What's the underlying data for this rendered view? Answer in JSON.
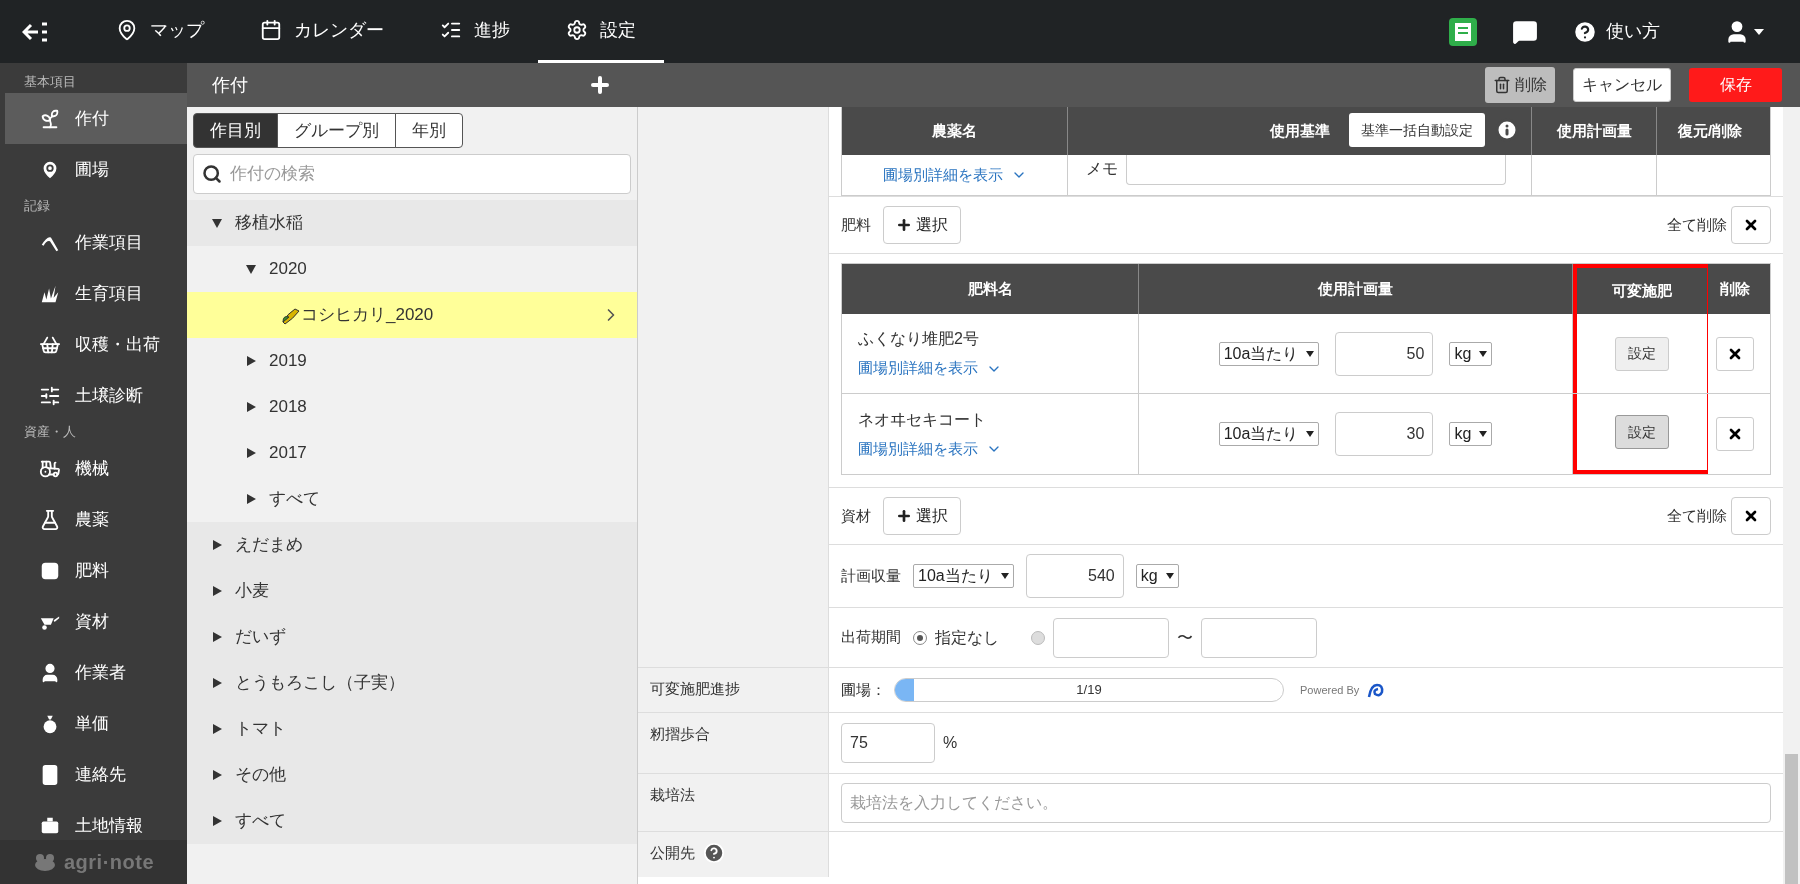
{
  "nav": {
    "items": [
      {
        "label": "マップ",
        "selected": false
      },
      {
        "label": "カレンダー",
        "selected": false
      },
      {
        "label": "進捗",
        "selected": false
      },
      {
        "label": "設定",
        "selected": true
      }
    ],
    "help": "使い方"
  },
  "sidebar": {
    "sections": [
      {
        "heading": "基本項目",
        "items": [
          {
            "label": "作付",
            "selected": true
          },
          {
            "label": "圃場",
            "selected": false
          }
        ]
      },
      {
        "heading": "記録",
        "items": [
          {
            "label": "作業項目",
            "selected": false
          },
          {
            "label": "生育項目",
            "selected": false
          },
          {
            "label": "収穫・出荷",
            "selected": false
          },
          {
            "label": "土壌診断",
            "selected": false
          }
        ]
      },
      {
        "heading": "資産・人",
        "items": [
          {
            "label": "機械",
            "selected": false
          },
          {
            "label": "農薬",
            "selected": false
          },
          {
            "label": "肥料",
            "selected": false
          },
          {
            "label": "資材",
            "selected": false
          },
          {
            "label": "作業者",
            "selected": false
          },
          {
            "label": "単価",
            "selected": false
          },
          {
            "label": "連絡先",
            "selected": false
          },
          {
            "label": "土地情報",
            "selected": false
          }
        ]
      }
    ],
    "logo": "agri·note"
  },
  "toolbar": {
    "title": "作付",
    "buttons": [
      {
        "label": "削除",
        "kind": "delete"
      },
      {
        "label": "キャンセル",
        "kind": "cancel"
      },
      {
        "label": "保存",
        "kind": "save"
      }
    ]
  },
  "tree": {
    "tabs": [
      {
        "label": "作目別",
        "selected": true
      },
      {
        "label": "グループ別",
        "selected": false
      },
      {
        "label": "年別",
        "selected": false
      }
    ],
    "search_placeholder": "作付の検索",
    "items": [
      {
        "label": "移植水稲",
        "kind": "group",
        "expanded": true,
        "selected": false,
        "children": [
          {
            "label": "2020",
            "kind": "group",
            "expanded": true,
            "selected": false,
            "children": [
              {
                "label": "コシヒカリ_2020",
                "kind": "crop",
                "selected": true
              }
            ]
          },
          {
            "label": "2019",
            "kind": "group",
            "expanded": false,
            "selected": false
          },
          {
            "label": "2018",
            "kind": "group",
            "expanded": false,
            "selected": false
          },
          {
            "label": "2017",
            "kind": "group",
            "expanded": false,
            "selected": false
          },
          {
            "label": "すべて",
            "kind": "group",
            "expanded": false,
            "selected": false
          }
        ]
      },
      {
        "label": "えだまめ",
        "kind": "group",
        "expanded": false,
        "selected": false
      },
      {
        "label": "小麦",
        "kind": "group",
        "expanded": false,
        "selected": false
      },
      {
        "label": "だいず",
        "kind": "group",
        "expanded": false,
        "selected": false
      },
      {
        "label": "とうもろこし（子実）",
        "kind": "group",
        "expanded": false,
        "selected": false
      },
      {
        "label": "トマト",
        "kind": "group",
        "expanded": false,
        "selected": false
      },
      {
        "label": "その他",
        "kind": "group",
        "expanded": false,
        "selected": false
      },
      {
        "label": "すべて",
        "kind": "group",
        "expanded": false,
        "selected": false
      }
    ]
  },
  "pesticide_table": {
    "columns": [
      "農薬名",
      "使用基準",
      "使用計画量",
      "復元/削除"
    ],
    "auto_button": "基準一括自動設定",
    "detail_link": "圃場別詳細を表示",
    "memo_label": "メモ"
  },
  "fertilizer": {
    "label": "肥料",
    "select_button": "選択",
    "clear_all": "全て削除",
    "columns": [
      {
        "label": "肥料名",
        "highlighted": false
      },
      {
        "label": "使用計画量",
        "highlighted": false
      },
      {
        "label": "可変施肥",
        "highlighted": true
      },
      {
        "label": "削除",
        "highlighted": false
      }
    ],
    "rows": [
      {
        "name": "ふくなり堆肥2号",
        "detail_link": "圃場別詳細を表示",
        "basis": "10a当たり",
        "amount": "50",
        "unit": "kg",
        "setting_button": "設定",
        "hovered": false
      },
      {
        "name": "ネオヰセキコート",
        "detail_link": "圃場別詳細を表示",
        "basis": "10a当たり",
        "amount": "30",
        "unit": "kg",
        "setting_button": "設定",
        "hovered": true
      }
    ]
  },
  "material": {
    "label": "資材",
    "select_button": "選択",
    "clear_all": "全て削除"
  },
  "yield": {
    "label": "計画収量",
    "basis": "10a当たり",
    "amount": "540",
    "unit": "kg"
  },
  "shipping": {
    "label": "出荷期間",
    "options": [
      {
        "kind": "none",
        "label": "指定なし",
        "selected": true
      },
      {
        "kind": "range",
        "separator": "〜",
        "selected": false
      }
    ]
  },
  "form_rows": [
    {
      "kind": "progress",
      "label": "可変施肥進捗",
      "prefix": "圃場：",
      "level": 0.05,
      "reading": "1/19",
      "credit": "Powered By"
    },
    {
      "kind": "percent",
      "label": "籾摺歩合",
      "value": "75",
      "suffix": "%"
    },
    {
      "kind": "text",
      "label": "栽培法",
      "placeholder": "栽培法を入力してください。"
    },
    {
      "kind": "help",
      "label": "公開先"
    }
  ]
}
